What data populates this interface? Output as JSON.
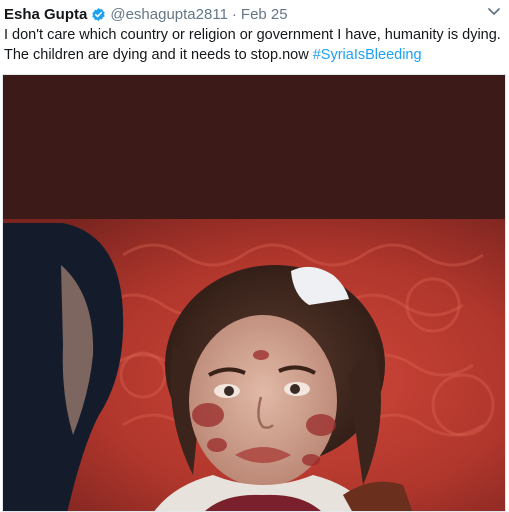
{
  "tweet": {
    "author_name": "Esha Gupta",
    "handle": "@eshagupta2811",
    "separator": "·",
    "date": "Feb 25",
    "text_line1": "I don't care which country or religion or government I have, humanity is dying.",
    "text_line2": "The children are dying and it needs to stop.now ",
    "hashtag": "#SyriaIsBleeding",
    "icons": {
      "verified": "verified-badge-icon",
      "menu": "chevron-down-icon"
    },
    "colors": {
      "accent": "#1da1f2",
      "name": "#14171a",
      "muted": "#657786"
    }
  }
}
